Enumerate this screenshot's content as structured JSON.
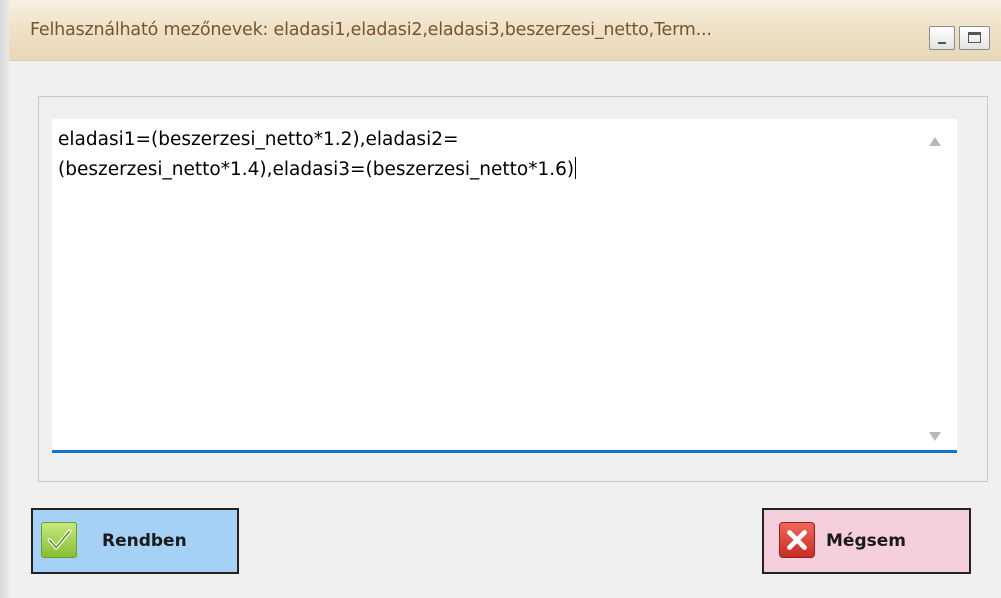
{
  "window": {
    "title": "Felhasználható mezőnevek: eladasi1,eladasi2,eladasi3,beszerzesi_netto,Term..."
  },
  "editor": {
    "value": "eladasi1=(beszerzesi_netto*1.2),eladasi2=\n(beszerzesi_netto*1.4),eladasi3=(beszerzesi_netto*1.6)"
  },
  "buttons": {
    "ok_label": "Rendben",
    "cancel_label": "Mégsem"
  },
  "colors": {
    "title_text": "#7a5428",
    "accent_underline": "#1473c8",
    "ok_button_bg": "#a6d1f6",
    "cancel_button_bg": "#f5d0dc"
  },
  "icons": {
    "ok": "check-icon",
    "cancel": "close-icon",
    "minimize": "minimize-icon",
    "maximize": "maximize-icon"
  }
}
